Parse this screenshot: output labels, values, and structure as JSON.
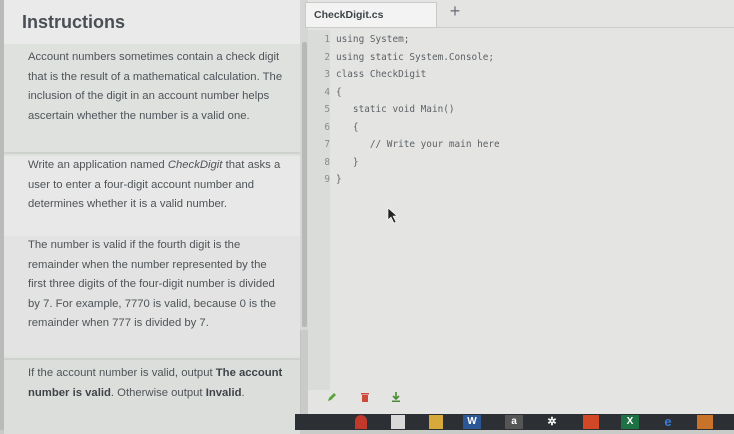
{
  "instructions": {
    "title": "Instructions",
    "para1": "Account numbers sometimes contain a check digit that is the result of a mathematical calculation. The inclusion of the digit in an account number helps ascertain whether the number is a valid one.",
    "para2_prefix": "Write an application named ",
    "para2_italic": "CheckDigit",
    "para2_suffix": " that asks a user to enter a four-digit account number and determines whether it is a valid number.",
    "para3": "The number is valid if the fourth digit is the remainder when the number represented by the first three digits of the four-digit number is divided by 7. For example, 7770 is valid, because 0 is the remainder when 777 is divided by 7.",
    "para4_prefix": "If the account number is valid, output ",
    "para4_bold1": "The account number is valid",
    "para4_mid": ". Otherwise output ",
    "para4_bold2": "Invalid",
    "para4_suffix": "."
  },
  "editor": {
    "tab_label": "CheckDigit.cs",
    "add_tab": "+",
    "lines": [
      {
        "n": "1",
        "code": "using System;"
      },
      {
        "n": "2",
        "code": "using static System.Console;"
      },
      {
        "n": "3",
        "code": "class CheckDigit"
      },
      {
        "n": "4",
        "code": "{"
      },
      {
        "n": "5",
        "code": "   static void Main()"
      },
      {
        "n": "6",
        "code": "   {"
      },
      {
        "n": "7",
        "code": "      // Write your main here"
      },
      {
        "n": "8",
        "code": "   }"
      },
      {
        "n": "9",
        "code": "}"
      }
    ]
  },
  "toolbar_icons": [
    "pencil-icon",
    "trash-icon",
    "download-icon"
  ],
  "taskbar": {
    "items": [
      "W",
      "a",
      "X",
      "e"
    ]
  },
  "colors": {
    "accent_green": "#5aa43c",
    "delete_red": "#d04a3c",
    "edge_blue": "#3a7bd5"
  }
}
